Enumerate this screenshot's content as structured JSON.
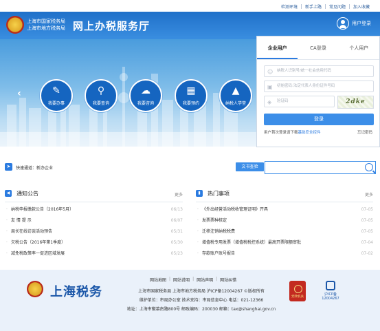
{
  "top_links": [
    "检测环境",
    "新手上路",
    "常见问题",
    "加入收藏"
  ],
  "header": {
    "emblem_caption": "中国税务",
    "bureau_line1": "上海市国家税务局",
    "bureau_line2": "上海市地方税务局",
    "title": "网上办税服务厅",
    "user_login": "用户登录"
  },
  "banner": {
    "prev_arrow": "‹",
    "next_arrow": "›",
    "quick": [
      {
        "label": "我要办事",
        "icon": "document-edit-icon"
      },
      {
        "label": "我要查询",
        "icon": "search-icon"
      },
      {
        "label": "我要咨询",
        "icon": "chat-bubble-icon"
      },
      {
        "label": "我要预约",
        "icon": "calendar-icon"
      },
      {
        "label": "纳税人学堂",
        "icon": "graduation-cap-icon"
      }
    ]
  },
  "login": {
    "tabs": [
      "企业用户",
      "CA登录",
      "个人用户"
    ],
    "active_tab": 0,
    "username_placeholder": "纳税人识别号/统一社会信用代码",
    "password_placeholder": "初始密码:法定代表人身份证件号码",
    "captcha_placeholder": "验证码",
    "captcha_text": "2dke",
    "login_button": "登录",
    "hint_prefix": "用户首次登录请下载",
    "hint_link": "基础安全控件",
    "forgot": "忘记密码"
  },
  "channel": {
    "label": "快速通道：",
    "value": "新办企业",
    "query_button": "文书查验",
    "search_value": ""
  },
  "notices": {
    "title": "通知公告",
    "more": "更多",
    "items": [
      {
        "text": "纳税申报缴款公告（2016年5月）",
        "date": "06/13"
      },
      {
        "text": "友 情 提 示",
        "date": "06/07"
      },
      {
        "text": "局长在线访谈活动预告",
        "date": "05/31"
      },
      {
        "text": "欠税公告（2016年第1季度）",
        "date": "05/30"
      },
      {
        "text": "减免税政策率一促进区域发展",
        "date": "05/23"
      }
    ]
  },
  "hot": {
    "title": "热门事项",
    "more": "更多",
    "items": [
      {
        "text": "《外出经营活动税收管理证明》开具",
        "date": "07-05"
      },
      {
        "text": "发票票种核定",
        "date": "07-05"
      },
      {
        "text": "迁移注销纳税税费",
        "date": "07-05"
      },
      {
        "text": "增值税专用发票（增值税税控系统）最高开票限额审批",
        "date": "07-04"
      },
      {
        "text": "存款账户账号报告",
        "date": "07-02"
      }
    ]
  },
  "footer": {
    "brand": "上海税务",
    "links": [
      "网站地图",
      "网站说明",
      "网站声明",
      "网站纠错"
    ],
    "line1": "上海市国家税务局 上海市地方税务局 沪ICP备12004267 ©版权所有",
    "line2": "维护单位：市局办公室   技术支持：市局信息中心 电话：021-12366",
    "line3": "地址：上海市徽慕南路800号   邮政编码：200030   邮箱：tax@shanghai.gov.cn",
    "badge1": "党政机关",
    "badge2": "沪ICP备\n12004267"
  },
  "colors": {
    "header_blue": "#1f70c9",
    "button_blue": "#3c8ee8",
    "brand_blue": "#1a56a8"
  }
}
